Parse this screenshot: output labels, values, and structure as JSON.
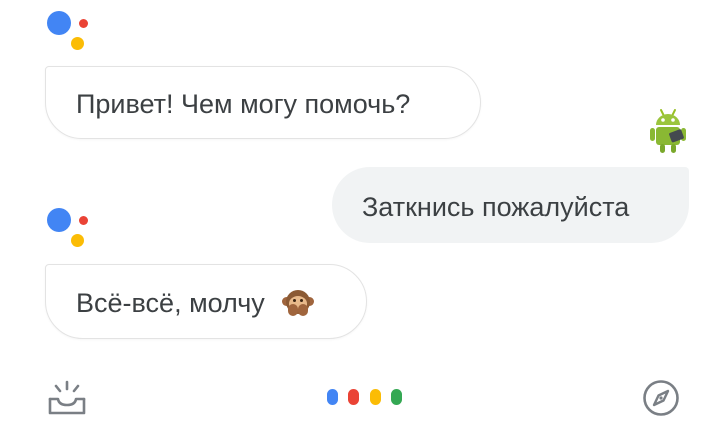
{
  "colors": {
    "google_blue": "#4285F4",
    "google_red": "#EA4335",
    "google_yellow": "#FBBC05",
    "google_green": "#34A853",
    "bubble_text": "#3c4043",
    "user_bubble_bg": "#f1f3f4",
    "icon_gray": "#7a7f85"
  },
  "conversation": {
    "assistant_greeting": "Привет! Чем могу помочь?",
    "user_message": "Заткнись пожалуйста",
    "assistant_reply": "Всё-всё, молчу",
    "assistant_reply_emoji": "speak-no-evil-monkey"
  },
  "avatar": {
    "icon": "android-robot-avatar"
  },
  "bottom_bar": {
    "left_icon": "updates-tray-icon",
    "center": "assistant-listening-dots",
    "right_icon": "explore-compass-icon"
  }
}
